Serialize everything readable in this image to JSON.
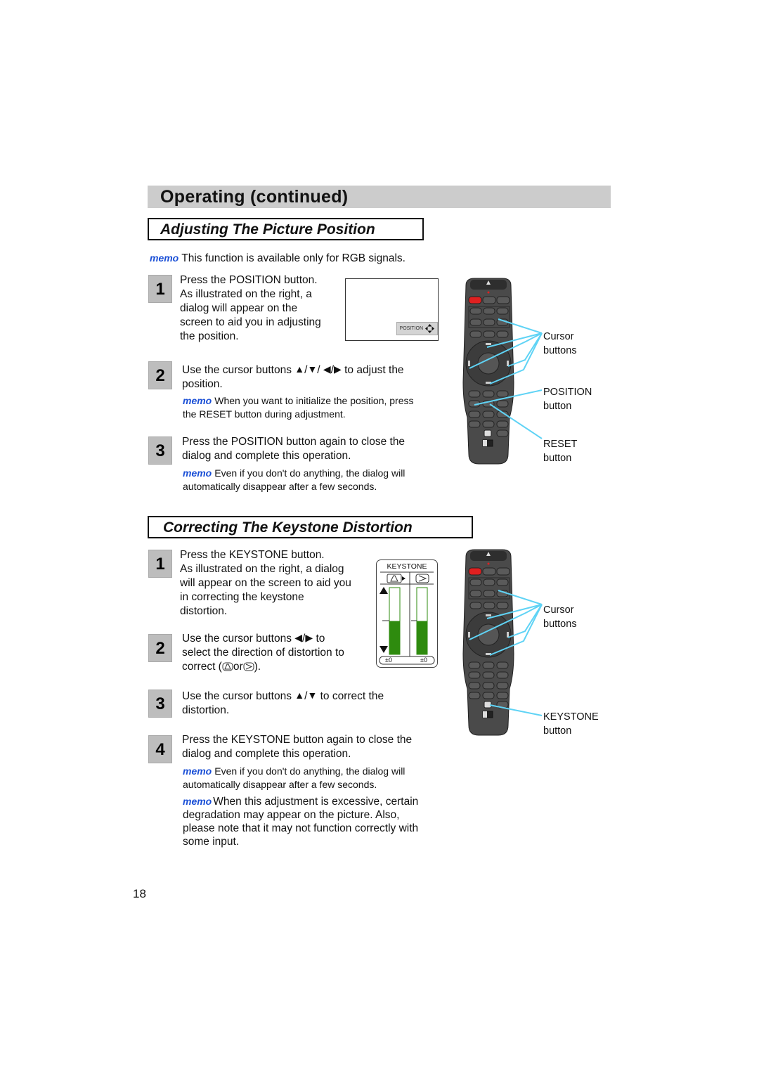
{
  "page": {
    "section_title": "Operating (continued)",
    "page_number": "18"
  },
  "position_section": {
    "heading": "Adjusting The Picture Position",
    "intro_memo": {
      "label": "memo",
      "text": "This function is available only for RGB signals."
    },
    "steps": [
      {
        "number": "1",
        "lines": [
          "Press the POSITION button.",
          "As illustrated on the right, a",
          "dialog will appear on the",
          "screen to aid you in adjusting",
          "the position."
        ]
      },
      {
        "number": "2",
        "text_before": "Use the cursor buttons",
        "text_after": "to adjust the",
        "line2": "position.",
        "arrows": [
          "up-triangle",
          "down-triangle",
          "left-triangle",
          "right-triangle"
        ],
        "memo": {
          "label": "memo",
          "line1": "When you want to initialize the position, press",
          "line2": "the RESET button during adjustment."
        }
      },
      {
        "number": "3",
        "line1": "Press the POSITION button again to close the",
        "line2": "dialog and complete this operation.",
        "memo": {
          "label": "memo",
          "line1": "Even if you don't do anything, the dialog will",
          "line2": "automatically disappear after a few seconds."
        }
      }
    ],
    "screen_dialog": {
      "label": "POSITION"
    },
    "remote_callouts": [
      {
        "line1": "Cursor",
        "line2": "buttons"
      },
      {
        "line1": "POSITION",
        "line2": "button"
      },
      {
        "line1": "RESET",
        "line2": "button"
      }
    ]
  },
  "keystone_section": {
    "heading": "Correcting The Keystone Distortion",
    "steps": [
      {
        "number": "1",
        "lines": [
          "Press the KEYSTONE button.",
          "As illustrated on the right, a dialog",
          "will appear on the screen to aid you",
          "in correcting the keystone",
          "distortion."
        ]
      },
      {
        "number": "2",
        "text_before": "Use the cursor buttons",
        "text_after": "to",
        "line2": "select the direction of distortion to",
        "line3_before": "correct (",
        "line3_mid": "or",
        "line3_after": ")."
      },
      {
        "number": "3",
        "text_before": "Use the cursor buttons",
        "text_after": "to correct the",
        "line2": "distortion."
      },
      {
        "number": "4",
        "line1": "Press the KEYSTONE button again to close the",
        "line2": "dialog and complete this operation.",
        "memo1": {
          "label": "memo",
          "line1": "Even if you don't do anything, the dialog will",
          "line2": "automatically disappear after a few seconds."
        },
        "memo2": {
          "label": "memo",
          "line1": "When this adjustment is excessive, certain",
          "line2": "degradation may appear on the picture. Also,",
          "line3": "please note that it may not function correctly with",
          "line4": "some input."
        }
      }
    ],
    "keystone_dialog": {
      "title": "KEYSTONE",
      "vertical_value": "±0",
      "horizontal_value": "±0",
      "vertical_level": 0.5,
      "horizontal_level": 0.5,
      "bar_color": "#2e8b0e"
    },
    "remote_callouts": [
      {
        "line1": "Cursor",
        "line2": "buttons"
      },
      {
        "line1": "KEYSTONE",
        "line2": "button"
      }
    ]
  },
  "colors": {
    "memo_blue": "#1a4fd6",
    "callout_line": "#5fd3f5",
    "section_bar": "#cccccc",
    "step_box": "#bdbdbd",
    "remote_body": "#4a4a4a",
    "power_red": "#e02020"
  }
}
